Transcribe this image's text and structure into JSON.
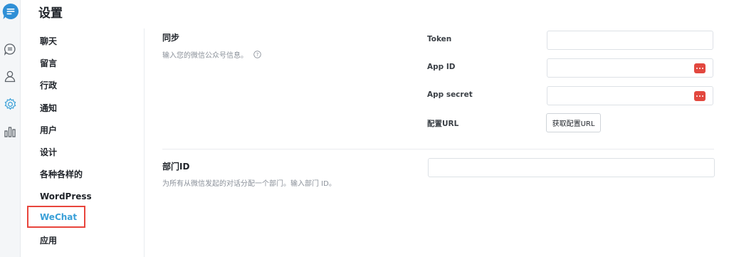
{
  "header": {
    "title": "设置"
  },
  "rail": {
    "icons": [
      "app-logo-icon",
      "chat-bubble-icon",
      "user-icon",
      "gear-icon",
      "bar-chart-icon"
    ],
    "accent_color": "#3aa0d8"
  },
  "nav": {
    "items": [
      {
        "label": "聊天"
      },
      {
        "label": "留言"
      },
      {
        "label": "行政"
      },
      {
        "label": "通知"
      },
      {
        "label": "用户"
      },
      {
        "label": "设计"
      },
      {
        "label": "各种各样的"
      },
      {
        "label": "WordPress"
      },
      {
        "label": "WeChat"
      },
      {
        "label": "应用"
      }
    ],
    "active": "WeChat",
    "active_color": "#3aa0d8",
    "highlight_color": "#e8453c"
  },
  "sync": {
    "title": "同步",
    "description": "输入您的微信公众号信息。",
    "fields": {
      "token": {
        "label": "Token",
        "value": ""
      },
      "app_id": {
        "label": "App ID",
        "value": ""
      },
      "app_secret": {
        "label": "App secret",
        "value": ""
      },
      "config_url": {
        "label": "配置URL",
        "button": "获取配置URL"
      }
    }
  },
  "department": {
    "title": "部门ID",
    "description": "为所有从微信发起的对话分配一个部门。输入部门 ID。",
    "value": ""
  }
}
